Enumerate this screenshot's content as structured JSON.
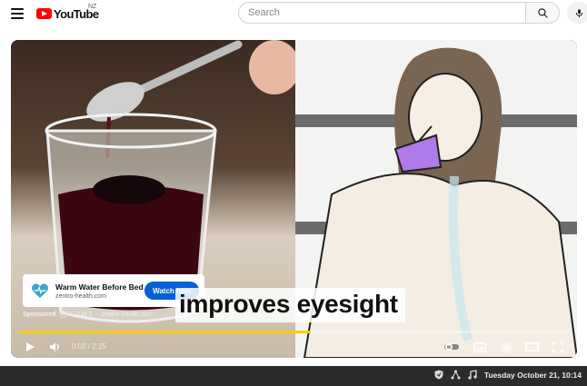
{
  "header": {
    "logo_text": "YouTube",
    "region": "NZ",
    "search_placeholder": "Search"
  },
  "video": {
    "caption": "improves eyesight",
    "ad": {
      "title": "Warm Water Before Bed",
      "domain": "zentro-health.com",
      "watch_label": "Watch now",
      "sponsored_label": "Sponsored",
      "ad_count": "2 of 2",
      "meta_domain": "zentro-health.com"
    },
    "time": "0:02 / 2:25",
    "progress_fraction": 0.53,
    "progress_color": "#ffcc00"
  },
  "taskbar": {
    "clock": "Tuesday October 21, 10:14"
  },
  "colors": {
    "brand_red": "#ff0000",
    "watch_button": "#065fd4"
  }
}
